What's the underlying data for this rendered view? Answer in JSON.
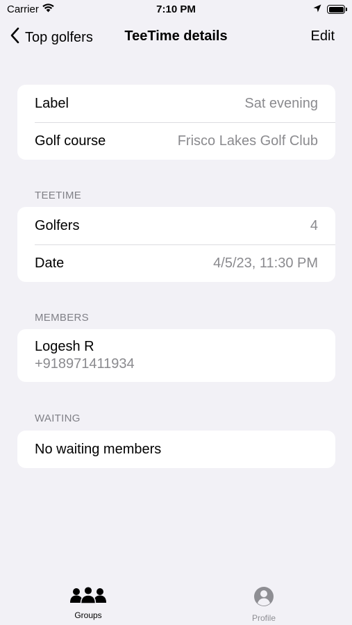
{
  "status_bar": {
    "carrier": "Carrier",
    "time": "7:10 PM"
  },
  "nav": {
    "back_label": "Top golfers",
    "title": "TeeTime details",
    "edit_label": "Edit"
  },
  "info": {
    "rows": [
      {
        "label": "Label",
        "value": "Sat evening"
      },
      {
        "label": "Golf course",
        "value": "Frisco Lakes Golf Club"
      }
    ]
  },
  "teetime": {
    "header": "TEETIME",
    "rows": [
      {
        "label": "Golfers",
        "value": "4"
      },
      {
        "label": "Date",
        "value": "4/5/23, 11:30 PM"
      }
    ]
  },
  "members": {
    "header": "MEMBERS",
    "items": [
      {
        "name": "Logesh R",
        "phone": "+918971411934"
      }
    ]
  },
  "waiting": {
    "header": "WAITING",
    "empty_text": "No waiting members"
  },
  "tabs": [
    {
      "label": "Groups",
      "icon": "people-icon",
      "active": true
    },
    {
      "label": "Profile",
      "icon": "person-circle-icon",
      "active": false
    }
  ],
  "colors": {
    "background": "#f2f1f6",
    "card": "#ffffff",
    "secondary_text": "#8a8a8e",
    "inactive_tab": "#8e8e93"
  }
}
